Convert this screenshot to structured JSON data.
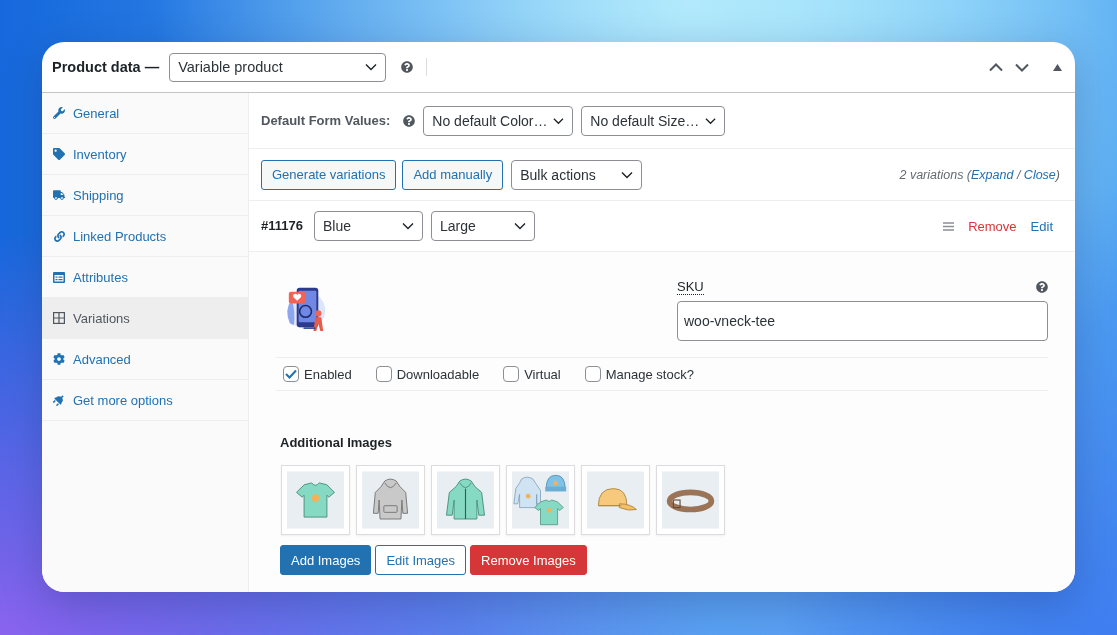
{
  "panel": {
    "title": "Product data —",
    "product_type": {
      "value": "Variable product"
    }
  },
  "tabs": [
    {
      "label": "General",
      "selected": false
    },
    {
      "label": "Inventory",
      "selected": false
    },
    {
      "label": "Shipping",
      "selected": false
    },
    {
      "label": "Linked Products",
      "selected": false
    },
    {
      "label": "Attributes",
      "selected": false
    },
    {
      "label": "Variations",
      "selected": true
    },
    {
      "label": "Advanced",
      "selected": false
    },
    {
      "label": "Get more options",
      "selected": false
    }
  ],
  "default_form_values": {
    "label": "Default Form Values:",
    "selects": [
      {
        "value": "No default Color…"
      },
      {
        "value": "No default Size…"
      }
    ]
  },
  "toolbar": {
    "buttons": [
      {
        "label": "Generate variations"
      },
      {
        "label": "Add manually"
      }
    ],
    "bulk_actions": {
      "value": "Bulk actions"
    },
    "summary": [
      {
        "text": "2 variations (",
        "kind": "text"
      },
      {
        "text": "Expand",
        "kind": "link"
      },
      {
        "text": " / ",
        "kind": "text"
      },
      {
        "text": "Close",
        "kind": "link"
      },
      {
        "text": ")",
        "kind": "text"
      }
    ]
  },
  "variation": {
    "id": "#11176",
    "attributes": [
      {
        "value": "Blue"
      },
      {
        "value": "Large"
      }
    ],
    "actions": [
      {
        "label": "Remove",
        "kind": "danger"
      },
      {
        "label": "Edit",
        "kind": "link"
      }
    ],
    "sku": {
      "label": "SKU",
      "value": "woo-vneck-tee"
    },
    "options": [
      {
        "label": "Enabled",
        "checked": true
      },
      {
        "label": "Downloadable",
        "checked": false
      },
      {
        "label": "Virtual",
        "checked": false
      },
      {
        "label": "Manage stock?",
        "checked": false
      }
    ],
    "additional_images": {
      "title": "Additional Images",
      "buttons": [
        {
          "label": "Add Images",
          "kind": "primary"
        },
        {
          "label": "Edit Images",
          "kind": "secondary"
        },
        {
          "label": "Remove Images",
          "kind": "danger"
        }
      ]
    }
  }
}
